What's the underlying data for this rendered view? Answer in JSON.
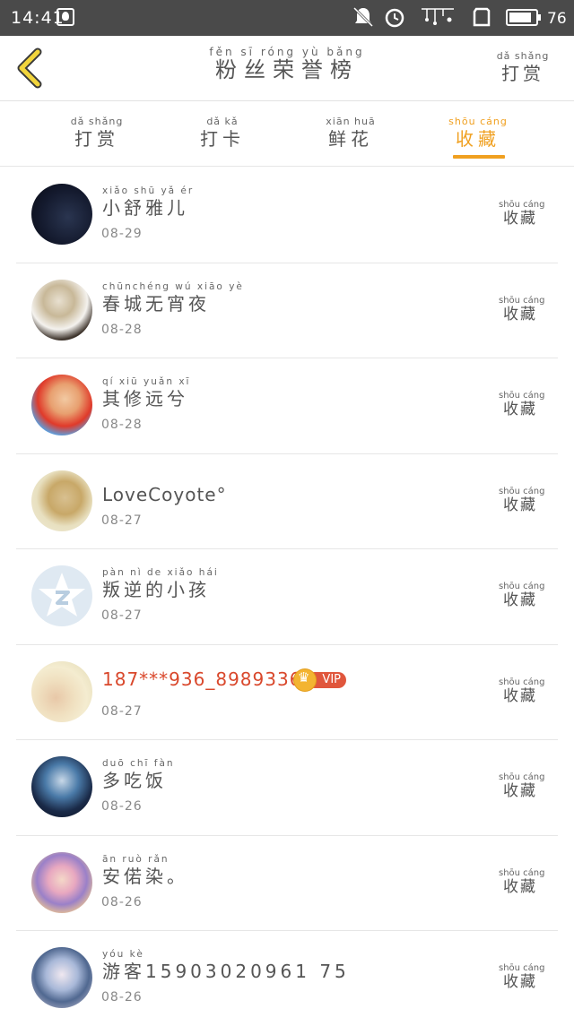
{
  "status_bar": {
    "time": "14:41",
    "battery": "76",
    "icons": [
      "qq-icon",
      "mute-icon",
      "alarm-icon",
      "signal-icon",
      "sim-icon",
      "battery-icon"
    ]
  },
  "header": {
    "title_pinyin": "fěn  sī  róng  yù  bǎng",
    "title": "粉丝荣誉榜",
    "right_pinyin": "dǎ shǎng",
    "right_label": "打赏"
  },
  "tabs": [
    {
      "pinyin": "dǎ shǎng",
      "label": "打赏",
      "active": false
    },
    {
      "pinyin": "dǎ  kǎ",
      "label": "打卡",
      "active": false
    },
    {
      "pinyin": "xiān huā",
      "label": "鲜花",
      "active": false
    },
    {
      "pinyin": "shōu cáng",
      "label": "收藏",
      "active": true
    }
  ],
  "action_pinyin": "shōu cáng",
  "action_label": "收藏",
  "users": [
    {
      "pinyin": "xiǎo  shū   yǎ    ér",
      "name": "小舒雅儿",
      "date": "08-29",
      "vip": false
    },
    {
      "pinyin": "chūnchéng wú  xiāo  yè",
      "name": "春城无宵夜",
      "date": "08-28",
      "vip": false
    },
    {
      "pinyin": "qí   xiū  yuǎn  xī",
      "name": "其修远兮",
      "date": "08-28",
      "vip": false
    },
    {
      "pinyin": "",
      "name": "LoveCoyote°",
      "date": "08-27",
      "vip": false
    },
    {
      "pinyin": "pàn  nì   de  xiǎo  hái",
      "name": "叛逆的小孩",
      "date": "08-27",
      "vip": false
    },
    {
      "pinyin": "",
      "name": "187***936_898933631",
      "date": "08-27",
      "vip": true,
      "vip_label": "VIP"
    },
    {
      "pinyin": "duō  chī  fàn",
      "name": "多吃饭",
      "date": "08-26",
      "vip": false
    },
    {
      "pinyin": "ān  ruò  rǎn",
      "name": "安偌染。",
      "date": "08-26",
      "vip": false
    },
    {
      "pinyin": "yóu  kè",
      "name": "游客15903020961 75",
      "date": "08-26",
      "vip": false
    }
  ],
  "colors": {
    "accent": "#f0a020",
    "status_bar": "#4a4a4a",
    "vip_name": "#d9482c",
    "vip_badge": "#e0563c"
  }
}
